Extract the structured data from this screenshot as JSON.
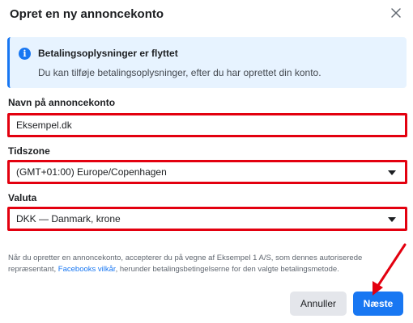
{
  "dialog": {
    "title": "Opret en ny annoncekonto",
    "close_icon": "close-icon"
  },
  "info": {
    "icon": "info-icon",
    "icon_glyph": "i",
    "title": "Betalingsoplysninger er flyttet",
    "body": "Du kan tilføje betalingsoplysninger, efter du har oprettet din konto."
  },
  "form": {
    "name_label": "Navn på annoncekonto",
    "name_value": "Eksempel.dk",
    "timezone_label": "Tidszone",
    "timezone_value": "(GMT+01:00) Europe/Copenhagen",
    "currency_label": "Valuta",
    "currency_value": "DKK — Danmark, krone"
  },
  "disclaimer": {
    "text_before": "Når du opretter en annoncekonto, accepterer du på vegne af Eksempel 1 A/S, som dennes autoriserede repræsentant, ",
    "link": "Facebooks vilkår",
    "text_after": ", herunder betalingsbetingelserne for den valgte betalingsmetode."
  },
  "buttons": {
    "cancel_label": "Annuller",
    "next_label": "Næste"
  },
  "colors": {
    "accent": "#1877f2",
    "highlight": "#e3000f",
    "info_bg": "#e7f3ff"
  }
}
